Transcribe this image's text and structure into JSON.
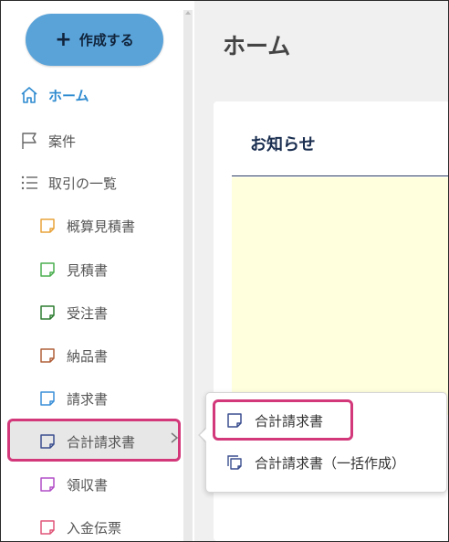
{
  "sidebar": {
    "create_button": "作成する",
    "nav": [
      {
        "label": "ホーム",
        "icon": "home-icon",
        "active": true
      },
      {
        "label": "案件",
        "icon": "flag-icon"
      },
      {
        "label": "取引の一覧",
        "icon": "list-icon"
      }
    ],
    "documents": [
      {
        "label": "概算見積書",
        "color": "#e8a33a"
      },
      {
        "label": "見積書",
        "color": "#4caf50"
      },
      {
        "label": "受注書",
        "color": "#2e7d32"
      },
      {
        "label": "納品書",
        "color": "#b0603a"
      },
      {
        "label": "請求書",
        "color": "#3a8fd8"
      },
      {
        "label": "合計請求書",
        "color": "#3b4f8f",
        "selected": true
      },
      {
        "label": "領収書",
        "color": "#b24fc7"
      },
      {
        "label": "入金伝票",
        "color": "#e0577a"
      }
    ]
  },
  "main": {
    "page_title": "ホーム",
    "card_title": "お知らせ"
  },
  "popup": {
    "items": [
      {
        "label": "合計請求書",
        "icon": "document-icon"
      },
      {
        "label": "合計請求書（一括作成）",
        "icon": "documents-stack-icon"
      }
    ]
  },
  "colors": {
    "accent": "#5aa3d9",
    "highlight": "#d2387a",
    "notice_bg": "#ffffdd"
  }
}
